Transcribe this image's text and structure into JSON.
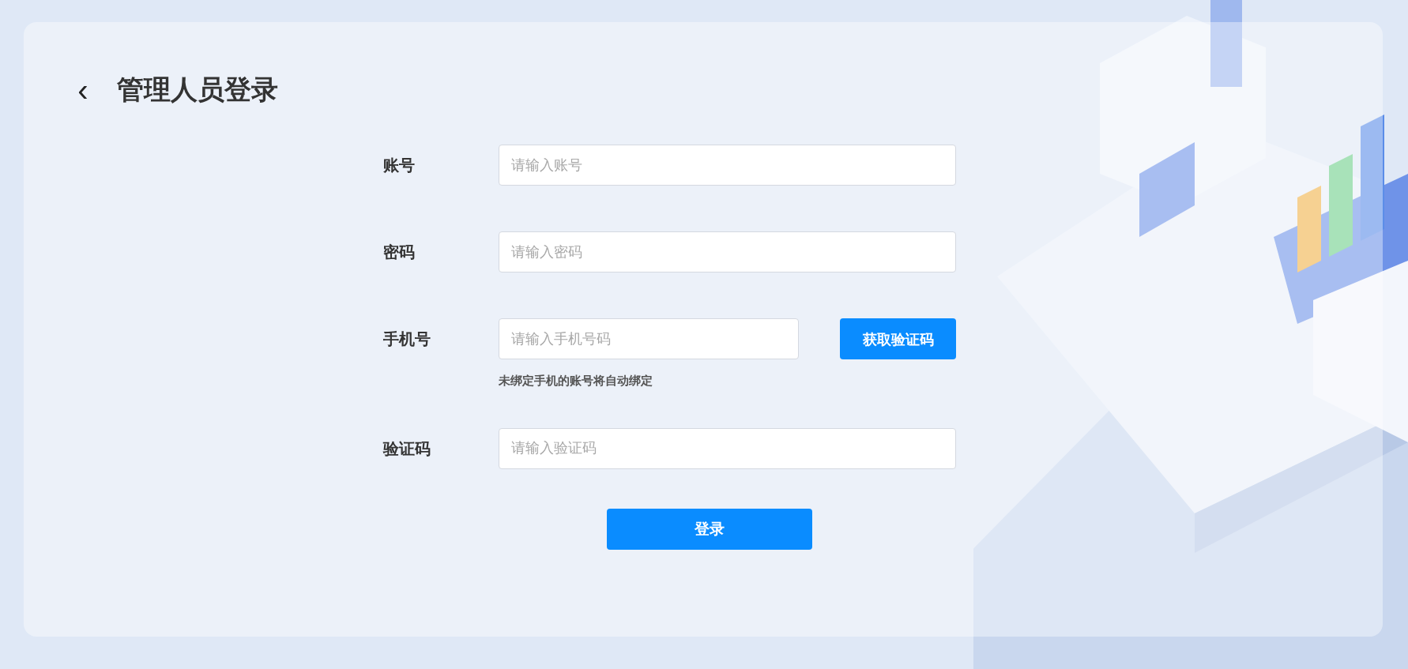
{
  "header": {
    "back_icon": "‹",
    "title": "管理人员登录"
  },
  "fields": [
    {
      "kind": "text",
      "label": "账号",
      "placeholder": "请输入账号"
    },
    {
      "kind": "text",
      "label": "密码",
      "placeholder": "请输入密码"
    },
    {
      "kind": "phone",
      "label": "手机号",
      "placeholder": "请输入手机号码",
      "button": "获取验证码",
      "hint": "未绑定手机的账号将自动绑定"
    },
    {
      "kind": "text",
      "label": "验证码",
      "placeholder": "请输入验证码"
    }
  ],
  "submit": "登录"
}
